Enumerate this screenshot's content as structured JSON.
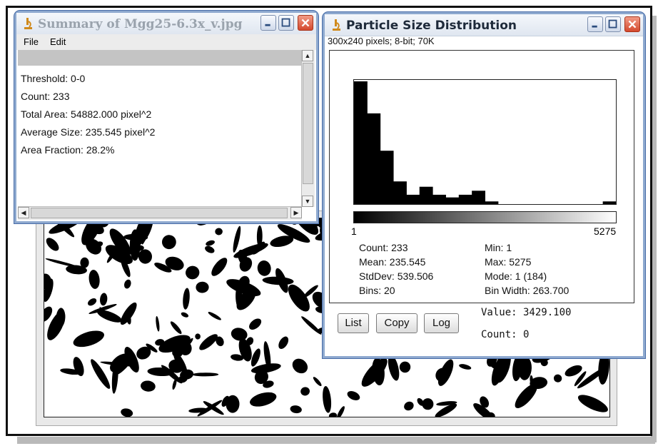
{
  "summary_window": {
    "title": "Summary of Mgg25-6.3x_v.jpg",
    "menu": [
      "File",
      "Edit"
    ],
    "lines": [
      "Threshold: 0-0",
      "Count: 233",
      "Total Area: 54882.000 pixel^2",
      "Average Size: 235.545 pixel^2",
      "Area Fraction: 28.2%"
    ]
  },
  "histogram_window": {
    "title": "Particle Size Distribution",
    "info": "300x240 pixels; 8-bit; 70K",
    "axis_min": "1",
    "axis_max": "5275",
    "stats_left": [
      "Count: 233",
      "Mean: 235.545",
      "StdDev: 539.506",
      "Bins: 20"
    ],
    "stats_right": [
      "Min: 1",
      "Max: 5275",
      "Mode: 1 (184)",
      "Bin Width: 263.700"
    ],
    "buttons": [
      "List",
      "Copy",
      "Log"
    ],
    "value_readout": "Value: 3429.100",
    "count_readout": "Count: 0"
  },
  "chart_data": {
    "type": "bar",
    "bins": 20,
    "x_range": [
      1,
      5275
    ],
    "values": [
      184,
      136,
      80,
      34,
      14,
      26,
      14,
      10,
      14,
      20,
      4,
      0,
      0,
      0,
      0,
      0,
      0,
      0,
      0,
      4
    ],
    "ylim": [
      0,
      184
    ]
  }
}
